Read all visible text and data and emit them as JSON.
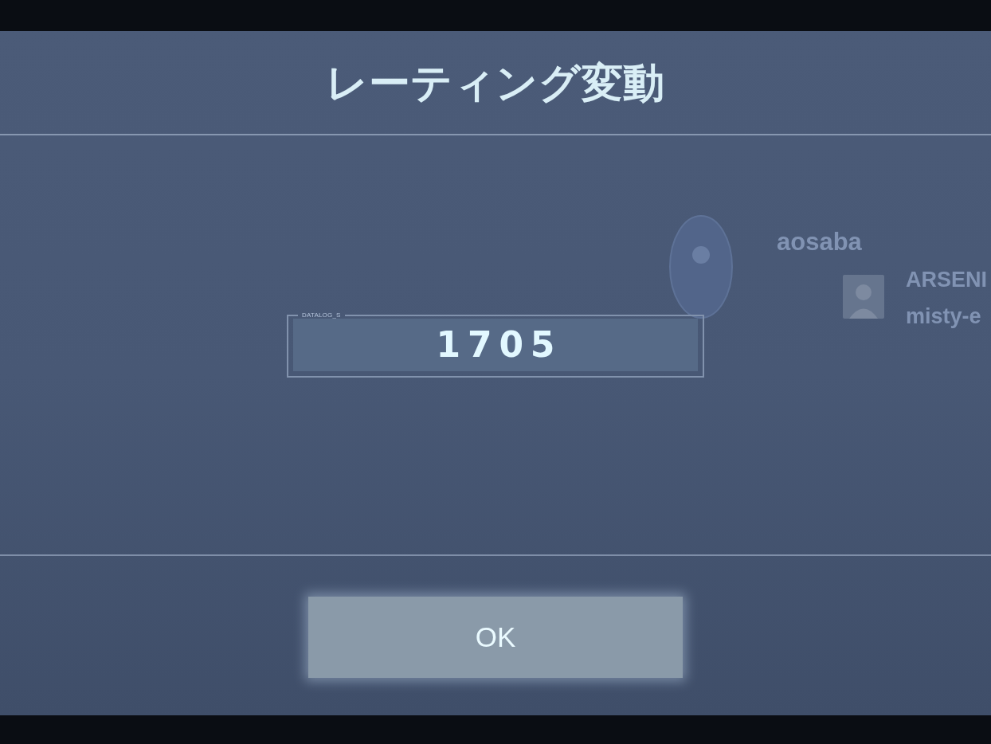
{
  "dialog": {
    "title": "レーティング変動",
    "field": {
      "label": "DATALOG_S",
      "value": "1705"
    },
    "buttons": [
      {
        "label": "OK"
      }
    ]
  },
  "background": {
    "players": [
      {
        "name": "aosaba"
      },
      {
        "name": "ARSENI"
      },
      {
        "name": "misty-e"
      }
    ]
  }
}
